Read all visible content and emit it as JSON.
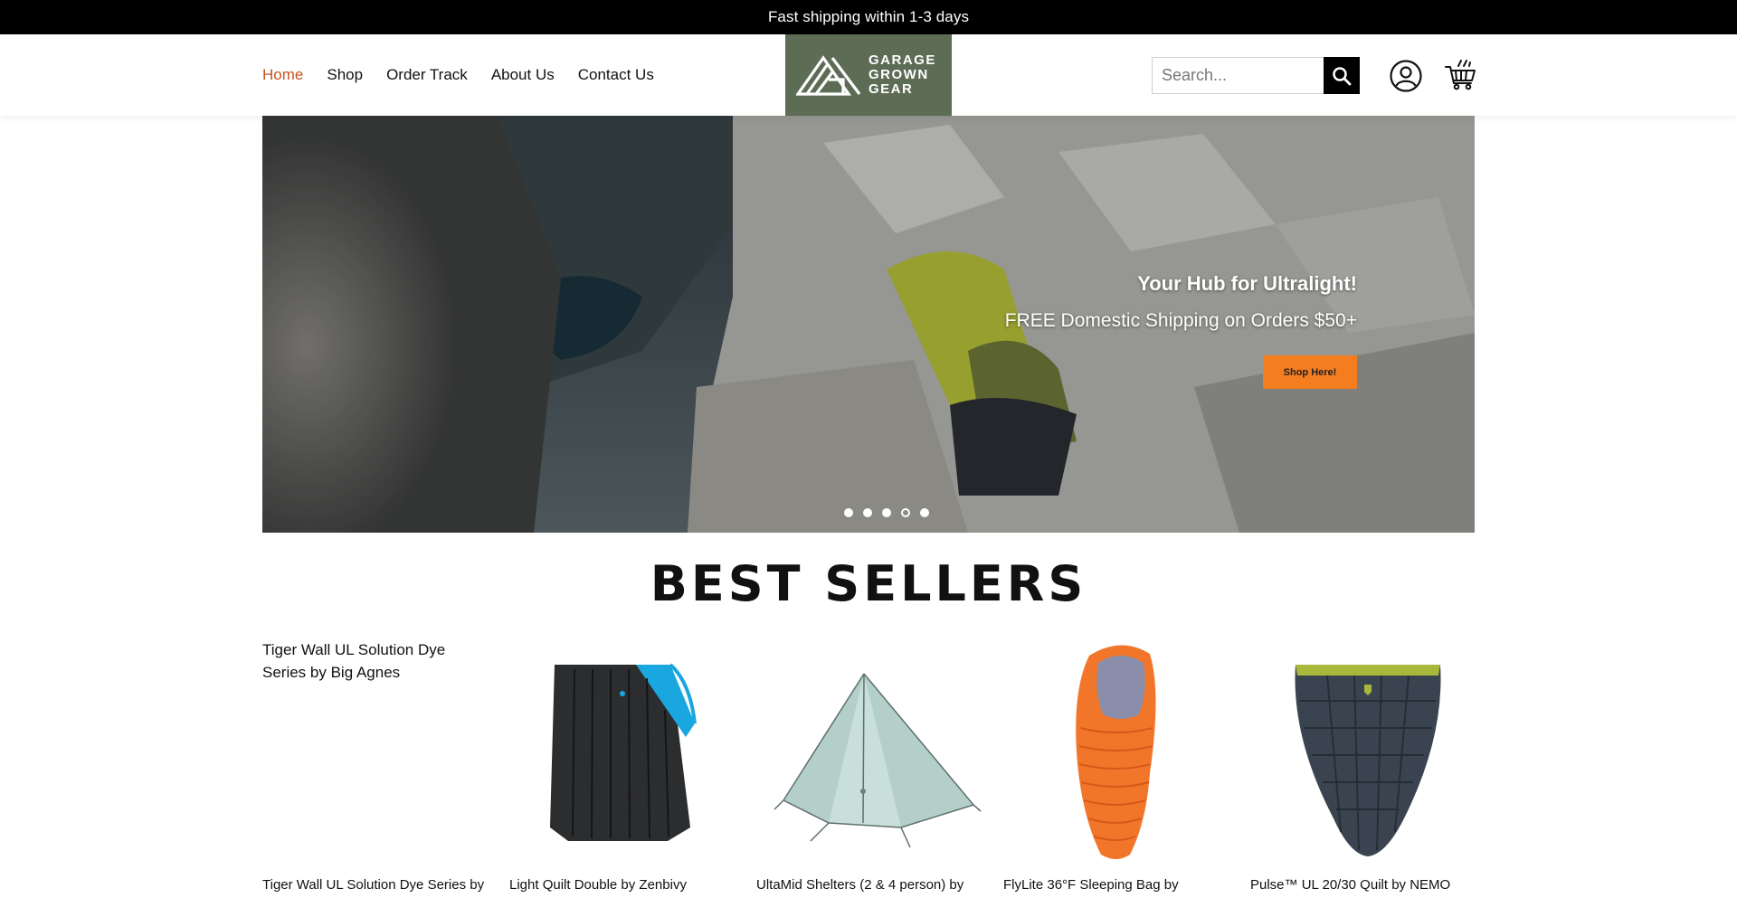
{
  "announcement": "Fast shipping within 1-3 days",
  "nav": {
    "items": [
      {
        "label": "Home",
        "active": true
      },
      {
        "label": "Shop"
      },
      {
        "label": "Order Track"
      },
      {
        "label": "About Us"
      },
      {
        "label": "Contact Us"
      }
    ]
  },
  "logo": {
    "line1": "GARAGE",
    "line2": "GROWN",
    "line3": "GEAR"
  },
  "search": {
    "placeholder": "Search..."
  },
  "hero": {
    "title": "Your Hub for Ultralight!",
    "subtitle": "FREE Domestic Shipping on Orders $50+",
    "cta": "Shop Here!",
    "slide_count": 5,
    "current_slide": 4
  },
  "best_sellers": {
    "title": "BEST SELLERS",
    "products": [
      {
        "name": "Tiger Wall UL Solution Dye Series by",
        "image_alt": "Tiger Wall UL Solution Dye Series by Big Agnes",
        "image": "broken"
      },
      {
        "name": "Light Quilt Double by Zenbivy",
        "image": "quilt-icon"
      },
      {
        "name": "UltaMid Shelters (2 & 4 person) by",
        "image": "tent-icon"
      },
      {
        "name": "FlyLite 36°F Sleeping Bag by",
        "image": "sleeping-bag-icon"
      },
      {
        "name": "Pulse™ UL 20/30 Quilt by NEMO",
        "image": "down-quilt-icon"
      }
    ]
  },
  "colors": {
    "accent": "#c8521f",
    "cta": "#f47d20",
    "logo_bg": "#5c6c55",
    "announcement_bg": "#000000"
  }
}
